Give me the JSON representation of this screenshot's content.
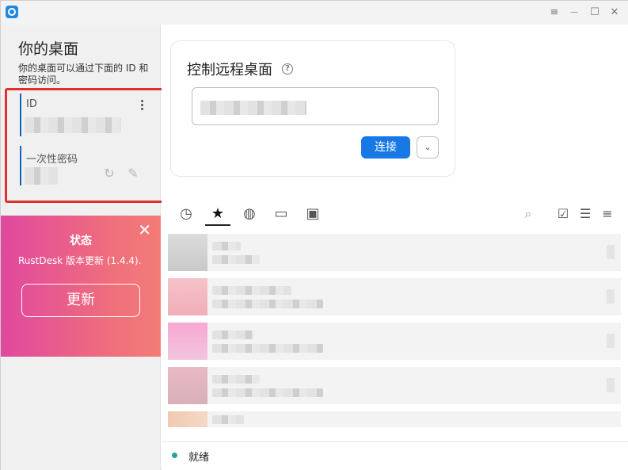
{
  "window": {
    "title_icon": "rustdesk-logo",
    "controls": {
      "menu": "≡",
      "minimize": "—",
      "maximize": "☐",
      "close": "✕"
    }
  },
  "sidebar": {
    "title": "你的桌面",
    "description": "你的桌面可以通过下面的 ID 和密码访问。",
    "id_label": "ID",
    "password_label": "一次性密码"
  },
  "update": {
    "title": "状态",
    "message": "RustDesk 版本更新 (1.4.4).",
    "button": "更新"
  },
  "main": {
    "connect_title": "控制远程桌面",
    "connect_button": "连接",
    "tabs": [
      "recent",
      "favorites",
      "discovered",
      "address-book-devices",
      "address-book"
    ],
    "tools": [
      "search",
      "select",
      "view-list",
      "sort"
    ]
  },
  "status": {
    "text": "就绪",
    "color": "#26a69a"
  },
  "colors": {
    "accent": "#1778e6",
    "highlight_border": "#e03131",
    "update_gradient_start": "#e1489f",
    "update_gradient_end": "#f47c78"
  }
}
